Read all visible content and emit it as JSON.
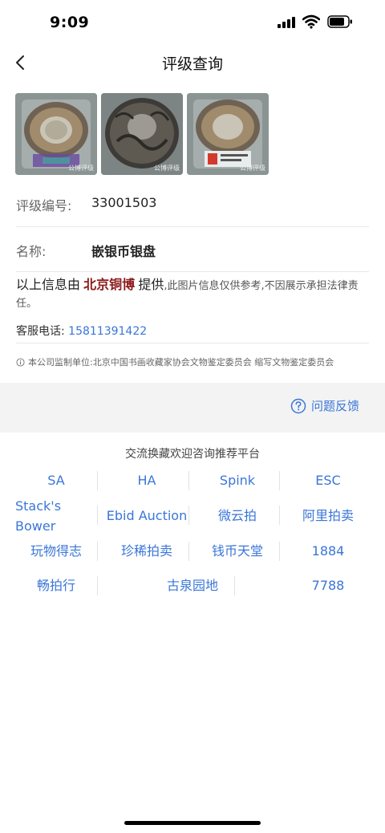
{
  "status": {
    "time": "9:09"
  },
  "nav": {
    "title": "评级查询"
  },
  "images": {
    "watermark_1": "公博评级",
    "watermark_2": "公博评级",
    "watermark_3": "公博评级"
  },
  "detail": {
    "grade_no_label": "评级编号:",
    "grade_no_value": "33001503",
    "name_label": "名称:",
    "name_value": "嵌银币银盘"
  },
  "notice": {
    "prefix": "以上信息由",
    "brand": "北京铜博",
    "provide": "提供",
    "rest": ",此图片信息仅供参考,不因展示承担法律责任。"
  },
  "contact": {
    "label": "客服电话:",
    "phone": "15811391422"
  },
  "supervision": "本公司监制单位:北京中国书画收藏家协会文物鉴定委员会 缩写文物鉴定委员会",
  "feedback": {
    "label": "问题反馈"
  },
  "platforms": {
    "title": "交流换藏欢迎咨询推荐平台",
    "row1": [
      "SA",
      "HA",
      "Spink",
      "ESC"
    ],
    "row2": [
      "Stack's Bower",
      "Ebid Auction",
      "微云拍",
      "阿里拍卖"
    ],
    "row3": [
      "玩物得志",
      "珍稀拍卖",
      "钱币天堂",
      "1884"
    ],
    "row4": [
      "畅拍行",
      "古泉园地",
      "7788"
    ]
  },
  "colors": {
    "accent": "#3a76d8",
    "brand": "#8b1a1a",
    "band": "#f3f3f3"
  }
}
